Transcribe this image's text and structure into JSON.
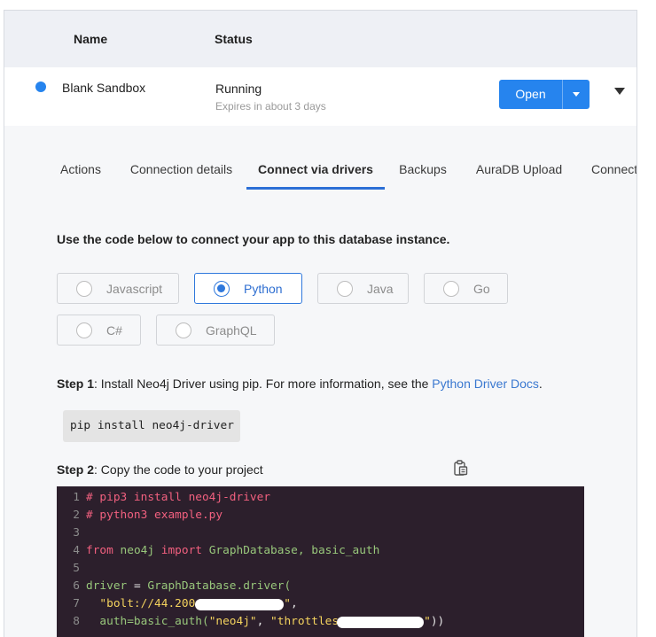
{
  "table": {
    "header": {
      "name": "Name",
      "status": "Status"
    },
    "row": {
      "name": "Blank Sandbox",
      "status": "Running",
      "expires": "Expires in about 3 days",
      "open_button": "Open"
    }
  },
  "tabs": [
    {
      "label": "Actions",
      "active": false
    },
    {
      "label": "Connection details",
      "active": false
    },
    {
      "label": "Connect via drivers",
      "active": true
    },
    {
      "label": "Backups",
      "active": false
    },
    {
      "label": "AuraDB Upload",
      "active": false
    },
    {
      "label": "Connect",
      "active": false
    }
  ],
  "intro": "Use the code below to connect your app to this database instance.",
  "languages": [
    {
      "label": "Javascript",
      "selected": false
    },
    {
      "label": "Python",
      "selected": true
    },
    {
      "label": "Java",
      "selected": false
    },
    {
      "label": "Go",
      "selected": false
    },
    {
      "label": "C#",
      "selected": false
    },
    {
      "label": "GraphQL",
      "selected": false
    }
  ],
  "step1": {
    "label": "Step 1",
    "text": ": Install Neo4j Driver using pip. For more information, see the ",
    "link": "Python Driver Docs",
    "suffix": "."
  },
  "install_command": "pip install neo4j-driver",
  "step2": {
    "label": "Step 2",
    "text": ": Copy the code to your project"
  },
  "code": {
    "lines": [
      {
        "number": "1",
        "tokens": [
          {
            "comment": "# pip3 install neo4j-driver"
          }
        ]
      },
      {
        "number": "2",
        "tokens": [
          {
            "comment": "# python3 example.py"
          }
        ]
      },
      {
        "number": "3",
        "tokens": []
      },
      {
        "number": "4",
        "tokens": [
          {
            "keyword": "from"
          },
          {
            "identifier": " neo4j "
          },
          {
            "keyword": "import"
          },
          {
            "identifier": " GraphDatabase, basic_auth"
          }
        ]
      },
      {
        "number": "5",
        "tokens": []
      },
      {
        "number": "6",
        "tokens": [
          {
            "identifier": "driver"
          },
          {
            "plain": " = "
          },
          {
            "identifier": "GraphDatabase.driver("
          }
        ]
      },
      {
        "number": "7",
        "tokens": [
          {
            "string": "  \"bolt://44.200"
          },
          {
            "redacted": true
          },
          {
            "string": "\""
          },
          {
            "plain": ","
          }
        ]
      },
      {
        "number": "8",
        "tokens": [
          {
            "identifier": "  auth=basic_auth("
          },
          {
            "string": "\"neo4j\""
          },
          {
            "plain": ", "
          },
          {
            "string": "\"throttles"
          },
          {
            "redacted": true
          },
          {
            "string": "\""
          },
          {
            "plain": "))"
          }
        ]
      }
    ]
  },
  "icons": {
    "status": "status-dot-icon",
    "open_menu": "caret-down-icon",
    "row_toggle": "caret-down-icon",
    "copy": "clipboard-icon"
  },
  "colors": {
    "accent": "#2684ee",
    "link": "#3a78d0",
    "tab_underline": "#2b6fd6",
    "selected": "#2f78dc",
    "code_bg": "#2c1f2c",
    "comment": "#f2607f",
    "keyword": "#f2607f",
    "identifier": "#98c77b",
    "string": "#f4d35e",
    "plain": "#e6e6e6"
  }
}
